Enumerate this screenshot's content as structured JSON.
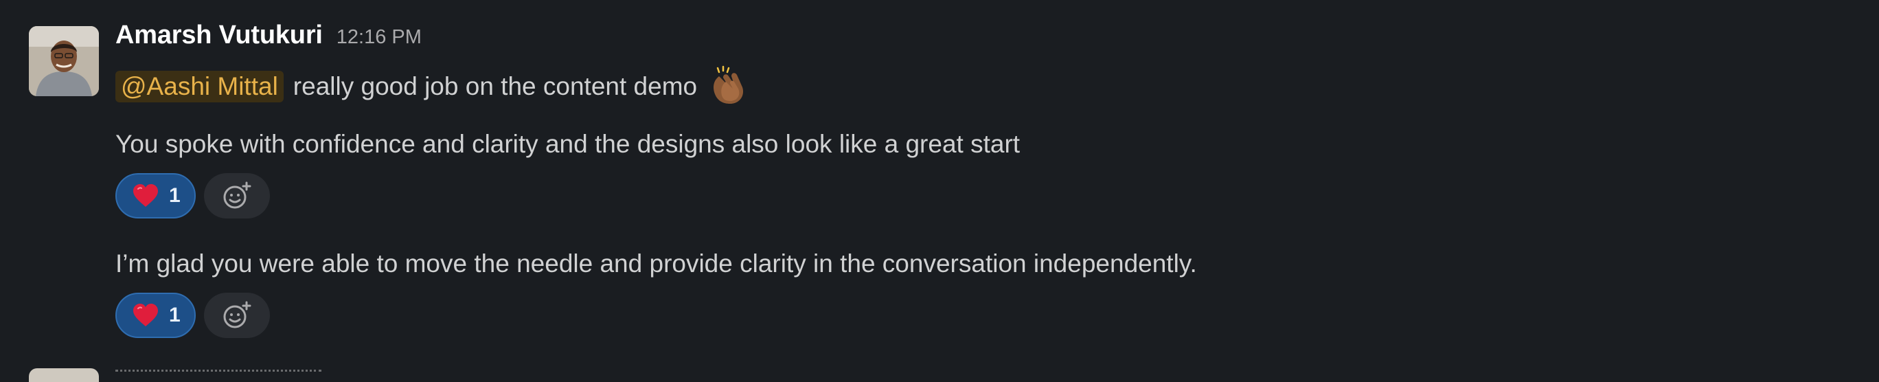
{
  "message": {
    "author": "Amarsh Vutukuri",
    "timestamp": "12:16 PM",
    "mention": "@Aashi Mittal",
    "line1_text": "really good job on the content demo",
    "line1_emoji": "clapping-hands",
    "line2_text": "You spoke with confidence and clarity and the designs also look like a great start",
    "line3_text": "I’m glad you were able to move the needle and provide clarity in the conversation independently."
  },
  "reactions": [
    {
      "emoji": "heart",
      "count": "1"
    },
    {
      "emoji": "heart",
      "count": "1"
    }
  ],
  "colors": {
    "background": "#1a1d21",
    "mention_bg": "#3b2f14",
    "mention_text": "#e8b24a",
    "reaction_bg": "#1d4f88",
    "reaction_border": "#2f6db0",
    "heart": "#e01e3c"
  }
}
